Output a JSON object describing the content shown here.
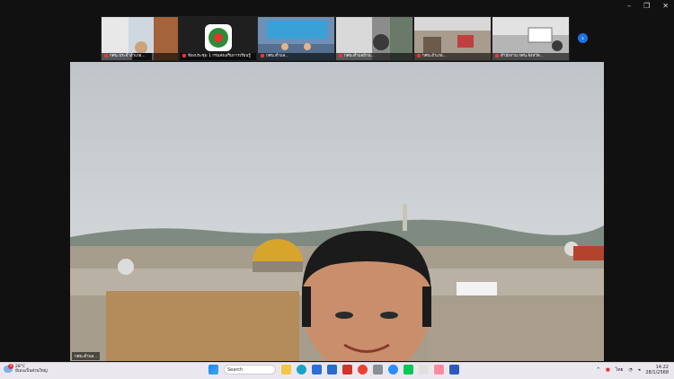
{
  "window_controls": {
    "minimize": "–",
    "restore": "❐",
    "close": "✕"
  },
  "participants": [
    {
      "name": "กศน.ประจำอำเภอ...",
      "bg": "#b8c4cf"
    },
    {
      "name": "ห้องประชุม 1 กรมส่งเสริมการเรียนรู้",
      "bg": "#1f1f1f"
    },
    {
      "name": "กศน.ตำบล...",
      "bg": "#6f8fb6"
    },
    {
      "name": "กศน.ตำบลบ้าน...",
      "bg": "#8c8c8c"
    },
    {
      "name": "กศน.อำเภอ...",
      "bg": "#a79c8d"
    },
    {
      "name": "สำนักงาน กศน.จังหวัด...",
      "bg": "#b5b5b5"
    }
  ],
  "stage": {
    "name_tag": "กศน.ตำบล..."
  },
  "taskbar": {
    "weather": {
      "temp": "28°C",
      "desc": "มีเมฆเป็นส่วนใหญ่",
      "badge": "1"
    },
    "search_label": "Search",
    "language": "ไทย",
    "time": "14:22",
    "date": "28/1/2568"
  }
}
